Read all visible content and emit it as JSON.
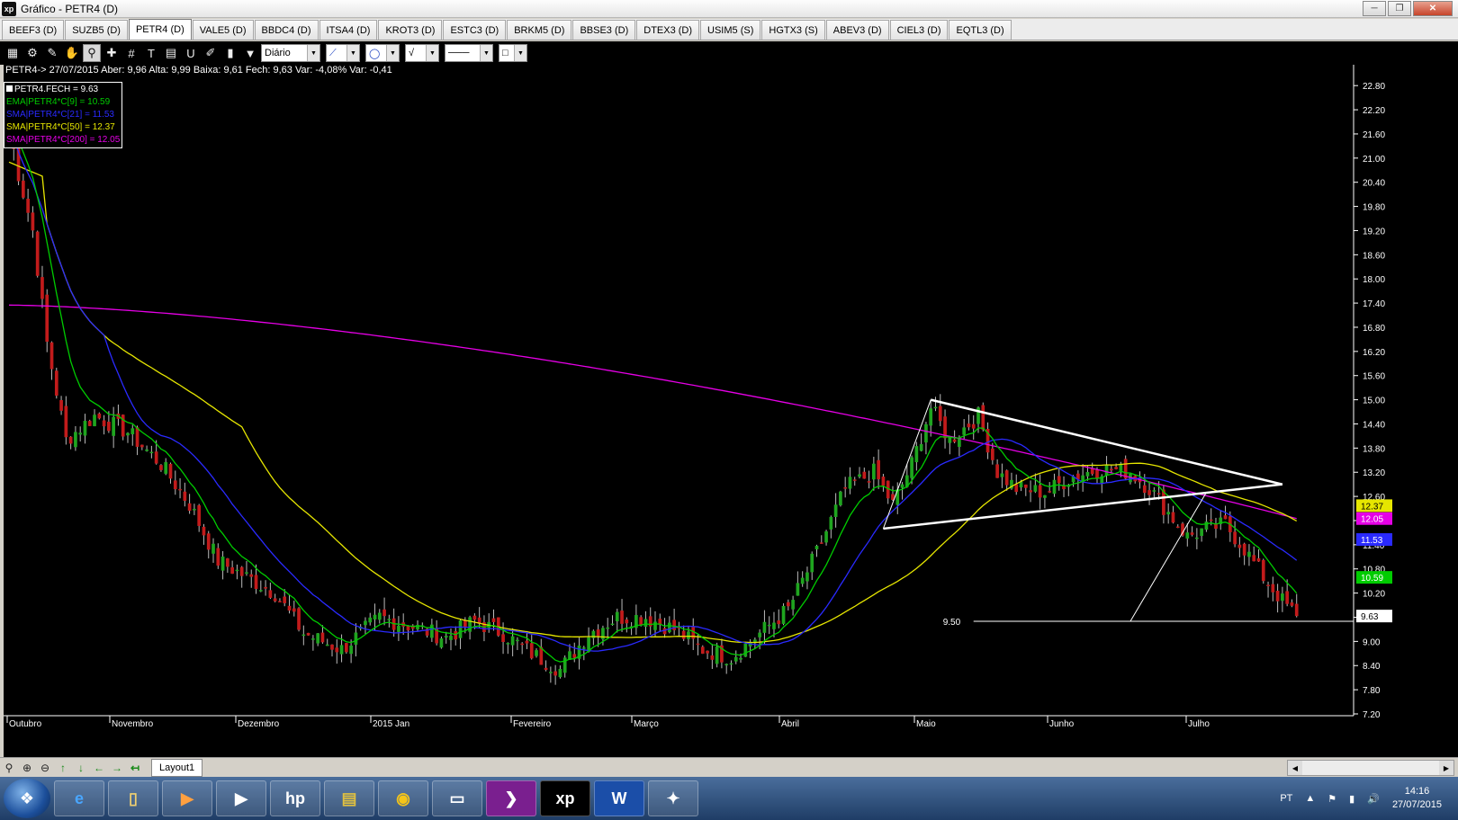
{
  "window": {
    "title": "Gráfico - PETR4 (D)",
    "app_icon": "xp"
  },
  "tabs": [
    "BEEF3 (D)",
    "SUZB5 (D)",
    "PETR4 (D)",
    "VALE5 (D)",
    "BBDC4 (D)",
    "ITSA4 (D)",
    "KROT3 (D)",
    "ESTC3 (D)",
    "BRKM5 (D)",
    "BBSE3 (D)",
    "DTEX3 (D)",
    "USIM5 (S)",
    "HGTX3 (S)",
    "ABEV3 (D)",
    "CIEL3 (D)",
    "EQTL3 (D)"
  ],
  "active_tab": 2,
  "toolbar": {
    "period": "Diário"
  },
  "quote": "PETR4-> 27/07/2015 Aber: 9,96 Alta: 9,99 Baixa: 9,61 Fech: 9,63 Var: -4,08% Var: -0,41",
  "legend": [
    {
      "label": "PETR4.FECH = 9.63",
      "color": "#ffffff"
    },
    {
      "label": "EMA|PETR4*C[9] = 10.59",
      "color": "#00cc00"
    },
    {
      "label": "SMA|PETR4*C[21] = 11.53",
      "color": "#2a2aff"
    },
    {
      "label": "SMA|PETR4*C[50] = 12.37",
      "color": "#e6e600"
    },
    {
      "label": "SMA|PETR4*C[200] = 12.05",
      "color": "#e600e6"
    }
  ],
  "chart_data": {
    "type": "candlestick",
    "y_ticks": [
      22.8,
      22.2,
      21.6,
      21.0,
      20.4,
      19.8,
      19.2,
      18.6,
      18.0,
      17.4,
      16.8,
      16.2,
      15.6,
      15.0,
      14.4,
      13.8,
      13.2,
      12.6,
      12.0,
      11.4,
      10.8,
      10.2,
      9.6,
      9.0,
      8.4,
      7.8,
      7.2
    ],
    "ylim": [
      7.2,
      23.0
    ],
    "x_months": [
      "Outubro",
      "Novembro",
      "Dezembro",
      "2015 Jan",
      "Fevereiro",
      "Março",
      "Abril",
      "Maio",
      "Junho",
      "Julho"
    ],
    "series": [
      {
        "name": "EMA|PETR4*C[9]",
        "value_label": "10.59",
        "color": "#00cc00"
      },
      {
        "name": "SMA|PETR4*C[21]",
        "value_label": "11.53",
        "color": "#2a2aff"
      },
      {
        "name": "SMA|PETR4*C[50]",
        "value_label": "12.37",
        "color": "#e6e600"
      },
      {
        "name": "SMA|PETR4*C[200]",
        "value_label": "12.05",
        "color": "#e600e6"
      }
    ],
    "last_price": "9.63",
    "support_line": {
      "label": "9.50",
      "y": 9.5
    },
    "up_color": "#1fa51f",
    "down_color": "#c21b1b",
    "key_points": [
      [
        0,
        21.8
      ],
      [
        2,
        20.6
      ],
      [
        5,
        19.2
      ],
      [
        8,
        16.4
      ],
      [
        12,
        14.0
      ],
      [
        18,
        14.6
      ],
      [
        25,
        14.2
      ],
      [
        32,
        13.4
      ],
      [
        38,
        12.4
      ],
      [
        44,
        11.0
      ],
      [
        50,
        10.6
      ],
      [
        56,
        10.2
      ],
      [
        62,
        9.2
      ],
      [
        70,
        8.8
      ],
      [
        78,
        9.6
      ],
      [
        84,
        9.4
      ],
      [
        92,
        9.1
      ],
      [
        98,
        9.5
      ],
      [
        104,
        9.2
      ],
      [
        110,
        8.7
      ],
      [
        116,
        8.3
      ],
      [
        122,
        9.2
      ],
      [
        128,
        9.6
      ],
      [
        134,
        9.6
      ],
      [
        140,
        9.3
      ],
      [
        146,
        8.8
      ],
      [
        152,
        8.6
      ],
      [
        158,
        9.2
      ],
      [
        164,
        9.8
      ],
      [
        170,
        11.2
      ],
      [
        176,
        12.8
      ],
      [
        182,
        13.2
      ],
      [
        186,
        12.4
      ],
      [
        190,
        13.4
      ],
      [
        194,
        14.8
      ],
      [
        198,
        14.0
      ],
      [
        204,
        14.6
      ],
      [
        208,
        13.2
      ],
      [
        212,
        12.8
      ],
      [
        218,
        12.7
      ],
      [
        224,
        13.1
      ],
      [
        230,
        13.3
      ],
      [
        236,
        13.2
      ],
      [
        240,
        12.8
      ],
      [
        244,
        12.2
      ],
      [
        248,
        11.6
      ],
      [
        252,
        11.8
      ],
      [
        256,
        11.9
      ],
      [
        260,
        11.3
      ],
      [
        264,
        10.6
      ],
      [
        268,
        10.0
      ],
      [
        271,
        9.63
      ]
    ]
  },
  "bottombar": {
    "layout_tab": "Layout1"
  },
  "taskbar": {
    "lang": "PT",
    "time": "14:16",
    "date": "27/07/2015"
  }
}
